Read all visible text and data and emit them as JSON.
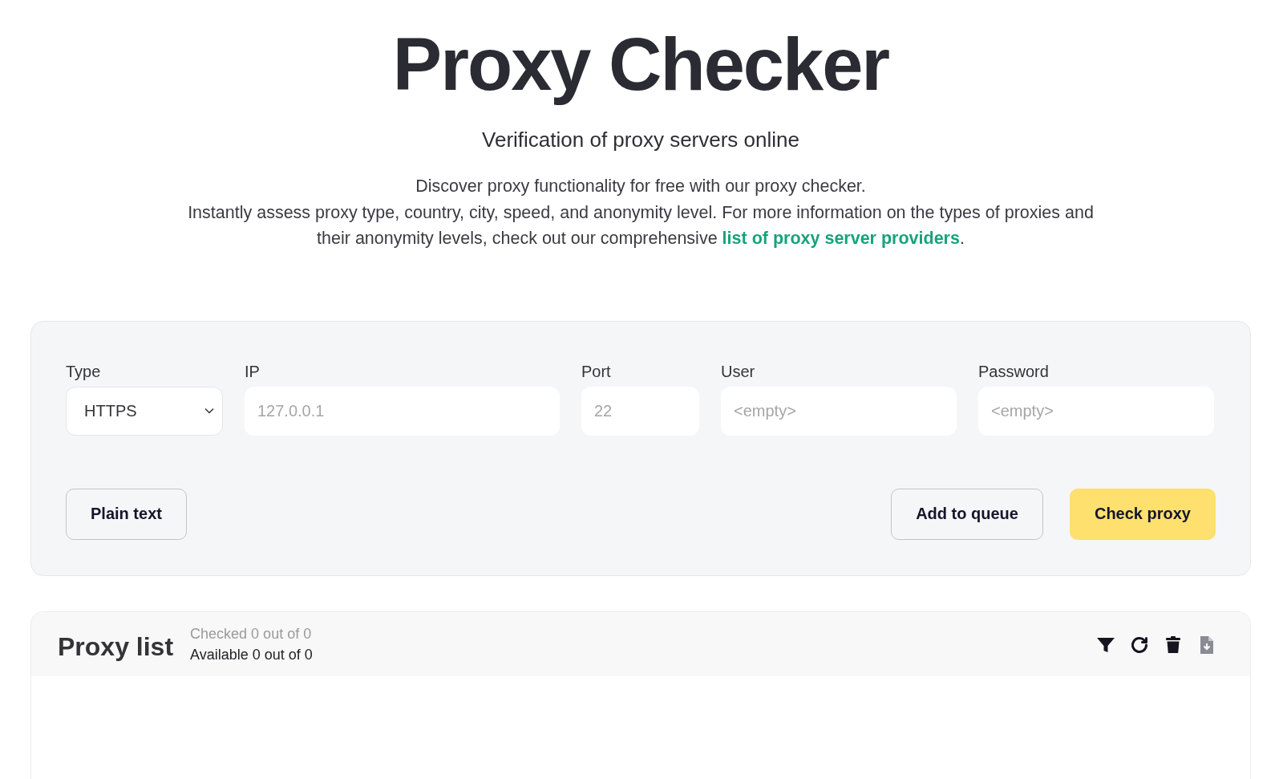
{
  "header": {
    "title": "Proxy Checker",
    "subtitle": "Verification of proxy servers online",
    "intro": "Discover proxy functionality for free with our proxy checker.",
    "details": "Instantly assess proxy type, country, city, speed, and anonymity level. For more information on the types of proxies and their anonymity levels, check out our comprehensive",
    "link": "list of proxy server providers",
    "details_end": "."
  },
  "form": {
    "fields": [
      {
        "kind": "select",
        "label": "Type",
        "value": "HTTPS"
      },
      {
        "kind": "text",
        "label": "IP",
        "placeholder": "127.0.0.1"
      },
      {
        "kind": "text",
        "label": "Port",
        "placeholder": "22"
      },
      {
        "kind": "text",
        "label": "User",
        "placeholder": "<empty>"
      },
      {
        "kind": "text",
        "label": "Password",
        "placeholder": "<empty>"
      }
    ],
    "left_buttons": [
      {
        "kind": "outline",
        "label": "Plain text"
      }
    ],
    "right_buttons": [
      {
        "kind": "outline",
        "label": "Add to queue"
      },
      {
        "kind": "primary",
        "label": "Check proxy"
      }
    ]
  },
  "proxy_list": {
    "title": "Proxy list",
    "checked": "Checked 0 out of 0",
    "available": "Available 0 out of 0",
    "tools": [
      {
        "kind": "filter",
        "disabled": false
      },
      {
        "kind": "refresh",
        "disabled": false
      },
      {
        "kind": "delete",
        "disabled": false
      },
      {
        "kind": "download",
        "disabled": true
      }
    ]
  }
}
